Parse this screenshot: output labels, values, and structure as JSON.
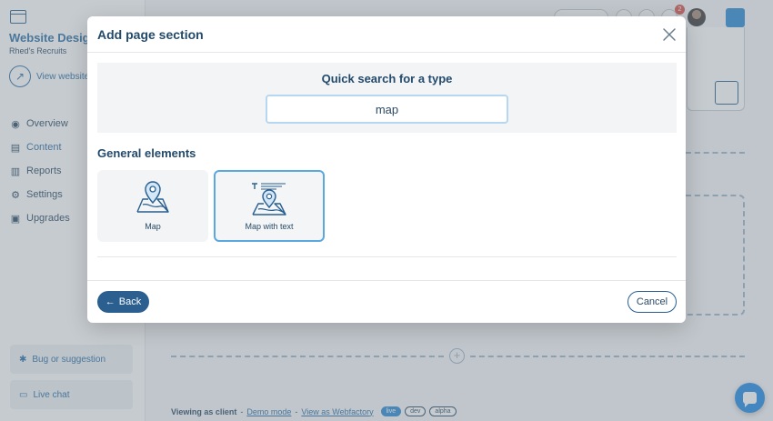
{
  "sidebar": {
    "site_title": "Website Desig",
    "site_subtitle": "Rhed's Recruits",
    "view_website": "View website",
    "nav": [
      {
        "label": "Overview",
        "icon": "radio-icon"
      },
      {
        "label": "Content",
        "icon": "content-icon",
        "active": true
      },
      {
        "label": "Reports",
        "icon": "chart-icon"
      },
      {
        "label": "Settings",
        "icon": "gear-icon"
      },
      {
        "label": "Upgrades",
        "icon": "upgrade-icon"
      }
    ],
    "bug_label": "Bug or suggestion",
    "chat_label": "Live chat"
  },
  "topbar": {
    "notification_count": "2"
  },
  "footer": {
    "viewing_prefix": "Viewing as client",
    "separator_1": "-",
    "demo_mode": "Demo mode",
    "separator_2": "-",
    "view_as": "View as Webfactory",
    "env_live": "live",
    "env_dev": "dev",
    "env_alpha": "alpha"
  },
  "modal": {
    "title": "Add page section",
    "search": {
      "heading": "Quick search for a type",
      "value": "map"
    },
    "section_heading": "General elements",
    "cards": [
      {
        "label": "Map",
        "icon": "map-pin-icon",
        "selected": false
      },
      {
        "label": "Map with text",
        "icon": "map-text-icon",
        "selected": true
      }
    ],
    "back_label": "Back",
    "cancel_label": "Cancel"
  },
  "colors": {
    "primary": "#2a5f8f",
    "accent": "#5aa8e0",
    "heading": "#234a6b",
    "chat_fab": "#1e88e5"
  }
}
